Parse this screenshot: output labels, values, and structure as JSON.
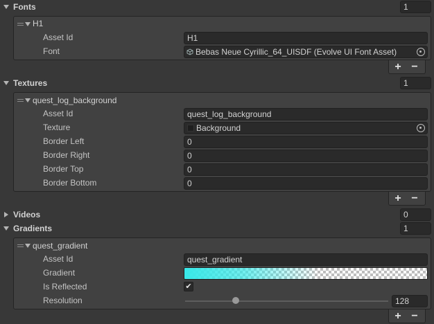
{
  "fonts": {
    "title": "Fonts",
    "count": "1",
    "expanded": true,
    "items": [
      {
        "name": "H1",
        "asset_id_label": "Asset Id",
        "asset_id": "H1",
        "font_label": "Font",
        "font_value": "Bebas Neue Cyrillic_64_UISDF (Evolve UI Font Asset)",
        "font_icon": "font-asset-icon"
      }
    ]
  },
  "textures": {
    "title": "Textures",
    "count": "1",
    "expanded": true,
    "items": [
      {
        "name": "quest_log_background",
        "asset_id_label": "Asset Id",
        "asset_id": "quest_log_background",
        "texture_label": "Texture",
        "texture_value": "Background",
        "texture_icon": "texture-icon",
        "border_left_label": "Border Left",
        "border_left": "0",
        "border_right_label": "Border Right",
        "border_right": "0",
        "border_top_label": "Border Top",
        "border_top": "0",
        "border_bottom_label": "Border Bottom",
        "border_bottom": "0"
      }
    ]
  },
  "videos": {
    "title": "Videos",
    "count": "0",
    "expanded": false
  },
  "gradients": {
    "title": "Gradients",
    "count": "1",
    "expanded": true,
    "items": [
      {
        "name": "quest_gradient",
        "asset_id_label": "Asset Id",
        "asset_id": "quest_gradient",
        "gradient_label": "Gradient",
        "gradient_color": "#38e8e8",
        "is_reflected_label": "Is Reflected",
        "is_reflected": true,
        "resolution_label": "Resolution",
        "resolution": "128",
        "resolution_slider_fraction": 0.25
      }
    ]
  },
  "footer": {
    "add_label": "+",
    "remove_label": "−"
  },
  "colors": {
    "background": "#383838",
    "panel": "#414141",
    "field": "#2a2a2a",
    "text": "#c8c8c8"
  }
}
